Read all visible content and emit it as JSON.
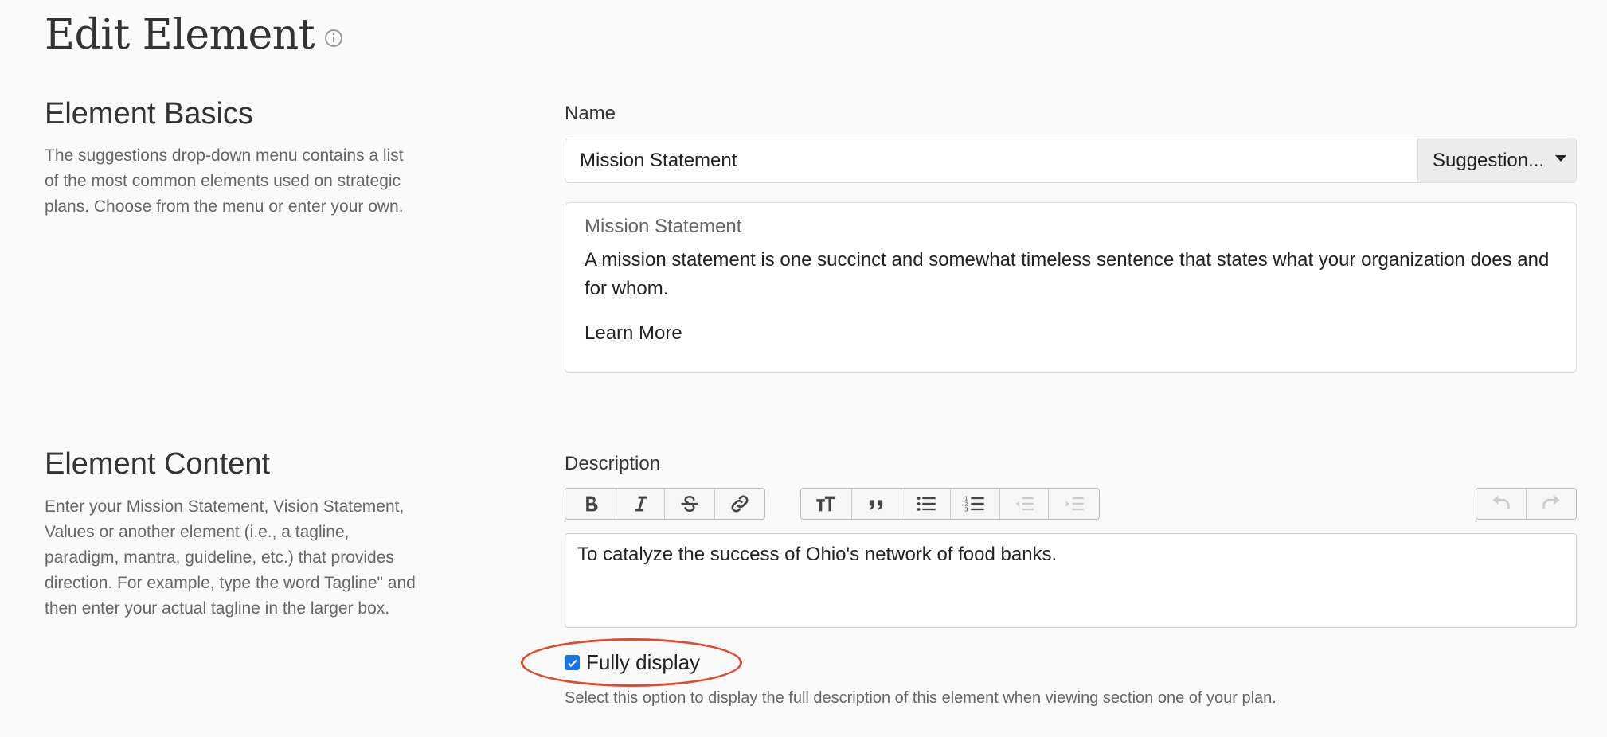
{
  "page": {
    "title": "Edit Element"
  },
  "basics": {
    "title": "Element Basics",
    "description": "The suggestions drop-down menu contains a list of the most common elements used on strategic plans. Choose from the menu or enter your own.",
    "name_label": "Name",
    "name_value": "Mission Statement",
    "suggestions_label": "Suggestion...",
    "card": {
      "title": "Mission Statement",
      "body": "A mission statement is one succinct and somewhat timeless sentence that states what your organization does and for whom.",
      "link": "Learn More"
    }
  },
  "content": {
    "title": "Element Content",
    "description": "Enter your Mission Statement, Vision Statement, Values or another element (i.e., a tagline, paradigm, mantra, guideline, etc.) that provides direction. For example, type the word Tagline\" and then enter your actual tagline in the larger box.",
    "description_label": "Description",
    "editor_text": "To catalyze the success of Ohio's network of food banks.",
    "fully_display_label": "Fully display",
    "fully_display_checked": true,
    "help_text": "Select this option to display the full description of this element when viewing section one of your plan."
  },
  "toolbar": {
    "icons": [
      "bold-icon",
      "italic-icon",
      "strikethrough-icon",
      "link-icon",
      "heading-icon",
      "quote-icon",
      "bullet-list-icon",
      "numbered-list-icon",
      "outdent-icon",
      "indent-icon",
      "undo-icon",
      "redo-icon"
    ]
  },
  "colors": {
    "accent": "#1a73e8",
    "highlight": "#e04a2f",
    "background": "#fafafa"
  }
}
